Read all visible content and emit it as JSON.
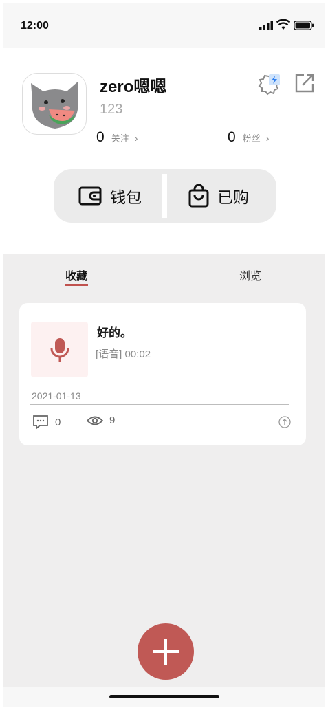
{
  "status_bar": {
    "time": "12:00"
  },
  "profile": {
    "username": "zero嗯嗯",
    "user_id": "123",
    "following": {
      "count": "0",
      "label": "关注"
    },
    "fans": {
      "count": "0",
      "label": "粉丝"
    }
  },
  "actions": {
    "wallet_label": "钱包",
    "purchased_label": "已购"
  },
  "tabs": [
    {
      "label": "收藏",
      "active": true
    },
    {
      "label": "浏览",
      "active": false
    }
  ],
  "card": {
    "title": "好的。",
    "subtitle": "[语音] 00:02",
    "date": "2021-01-13",
    "comments": "0",
    "views": "9"
  },
  "colors": {
    "accent": "#c05955",
    "background": "#efeeee"
  },
  "icons": [
    "signal-icon",
    "wifi-icon",
    "battery-icon",
    "settings-icon",
    "share-icon",
    "wallet-icon",
    "bag-icon",
    "microphone-icon",
    "comment-icon",
    "eye-icon",
    "upload-icon",
    "plus-icon"
  ]
}
